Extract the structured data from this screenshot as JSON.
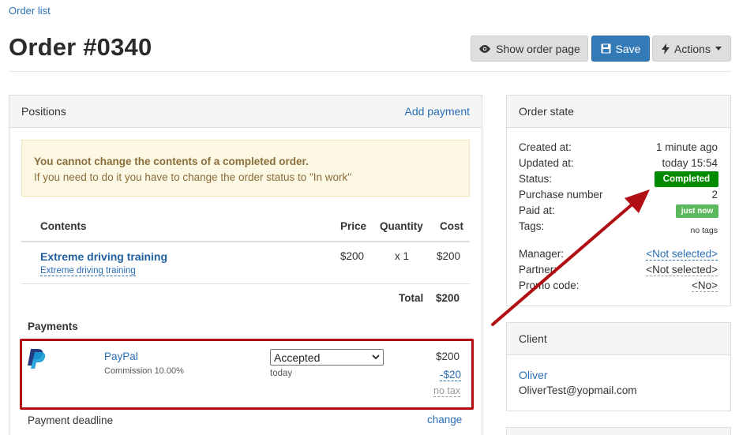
{
  "breadcrumb": {
    "order_list": "Order list"
  },
  "page": {
    "title": "Order #0340"
  },
  "toolbar": {
    "show_order_page": "Show order page",
    "save": "Save",
    "actions": "Actions"
  },
  "positions": {
    "header": "Positions",
    "add_payment": "Add payment",
    "alert_title": "You cannot change the contents of a completed order.",
    "alert_text": "If you need to do it you have to change the order status to \"In work\"",
    "columns": {
      "contents": "Contents",
      "price": "Price",
      "quantity": "Quantity",
      "cost": "Cost"
    },
    "item": {
      "title": "Extreme driving training",
      "subtitle": "Extreme driving training",
      "price": "$200",
      "quantity": "x 1",
      "cost": "$200"
    },
    "total_label": "Total",
    "total_value": "$200"
  },
  "payments": {
    "header": "Payments",
    "method": "PayPal",
    "commission": "Commission 10.00%",
    "status_selected": "Accepted",
    "date": "today",
    "amount": "$200",
    "commission_amount": "-$20",
    "tax": "no tax",
    "deadline_label": "Payment deadline",
    "deadline_change": "change"
  },
  "order_state": {
    "header": "Order state",
    "created_label": "Created at:",
    "created_value": "1 minute ago",
    "updated_label": "Updated at:",
    "updated_value": "today 15:54",
    "status_label": "Status:",
    "status_value": "Completed",
    "purchase_label": "Purchase number",
    "purchase_value": "2",
    "paid_label": "Paid at:",
    "paid_value": "just now",
    "tags_label": "Tags:",
    "tags_value": "no tags",
    "manager_label": "Manager:",
    "manager_value": "<Not selected>",
    "partner_label": "Partner:",
    "partner_value": "<Not selected>",
    "promo_label": "Promo code:",
    "promo_value": "<No>"
  },
  "client": {
    "header": "Client",
    "name": "Oliver",
    "email": "OliverTest@yopmail.com"
  },
  "colors": {
    "primary": "#337ab7",
    "link": "#2a6fb5",
    "status_completed": "#008a00",
    "paid_badge": "#5cb85c",
    "highlight": "#b10f14",
    "alert_bg": "#fcf8e3"
  }
}
